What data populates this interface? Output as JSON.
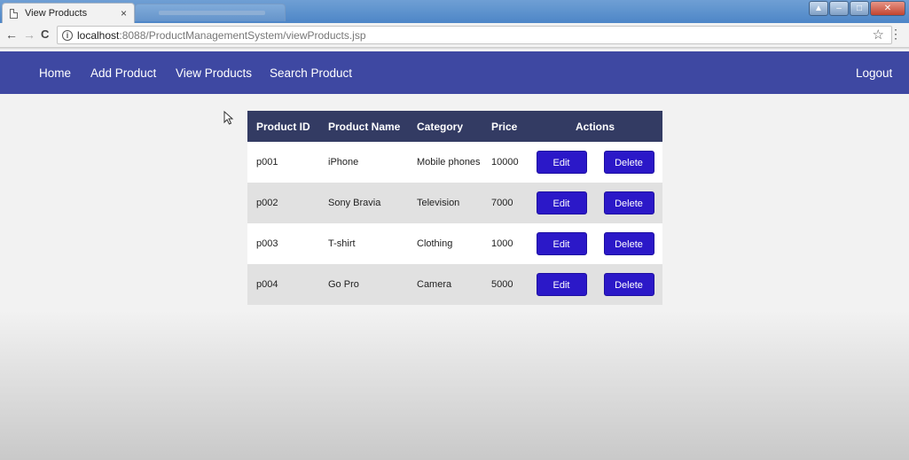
{
  "browser": {
    "tab_title": "View Products",
    "tab_close": "×",
    "url_host": "localhost",
    "url_path": ":8088/ProductManagementSystem/viewProducts.jsp",
    "back": "←",
    "forward": "→",
    "reload": "C",
    "info": "i",
    "star": "☆",
    "menu": "⋮"
  },
  "navbar": {
    "home": "Home",
    "add_product": "Add Product",
    "view_products": "View Products",
    "search_product": "Search Product",
    "logout": "Logout"
  },
  "table": {
    "headers": [
      "Product ID",
      "Product Name",
      "Category",
      "Price",
      "Actions"
    ],
    "rows": [
      {
        "id": "p001",
        "name": "iPhone",
        "category": "Mobile phones",
        "price": "10000"
      },
      {
        "id": "p002",
        "name": "Sony Bravia",
        "category": "Television",
        "price": "7000"
      },
      {
        "id": "p003",
        "name": "T-shirt",
        "category": "Clothing",
        "price": "1000"
      },
      {
        "id": "p004",
        "name": "Go Pro",
        "category": "Camera",
        "price": "5000"
      }
    ],
    "edit_label": "Edit",
    "delete_label": "Delete"
  },
  "colors": {
    "navbar": "#3e48a2",
    "table_header": "#333b63",
    "button": "#2b18c8"
  }
}
